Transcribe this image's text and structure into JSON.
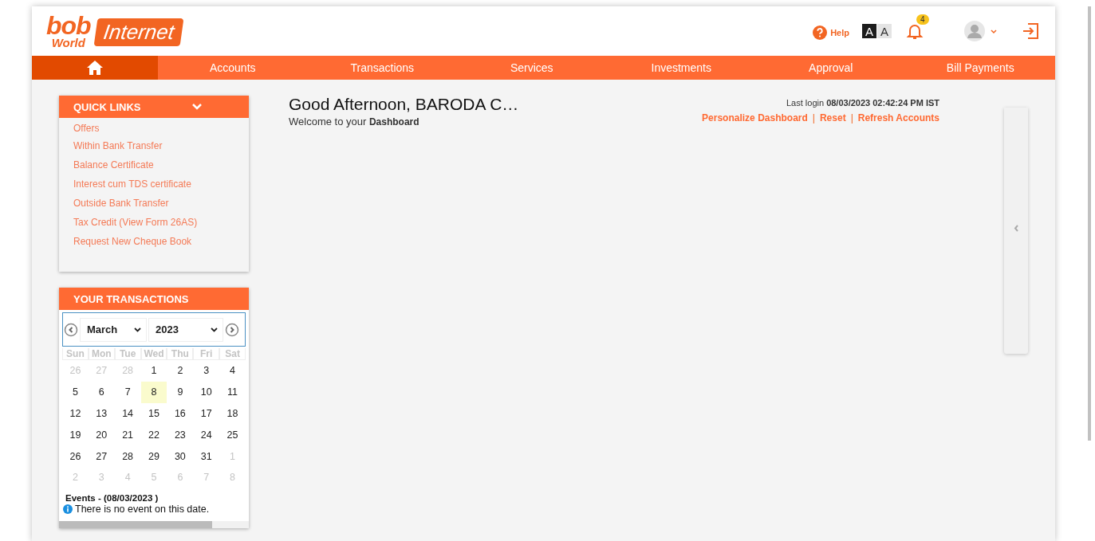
{
  "logo": {
    "brand": "bob",
    "sub": "World",
    "product": "Internet"
  },
  "header": {
    "help": "Help",
    "font_sizes": [
      {
        "label": "A",
        "selected": true
      },
      {
        "label": "A",
        "selected": false
      }
    ],
    "notifications": "4"
  },
  "nav": {
    "home_selected": true,
    "items": [
      {
        "label": "Accounts",
        "selected": false
      },
      {
        "label": "Transactions",
        "selected": false
      },
      {
        "label": "Services",
        "selected": false
      },
      {
        "label": "Investments",
        "selected": false
      },
      {
        "label": "Approval",
        "selected": false
      },
      {
        "label": "Bill Payments",
        "selected": false
      }
    ]
  },
  "quick_links": {
    "title": "QUICK LINKS",
    "expanded": true,
    "items": [
      "Offers",
      "Within Bank Transfer",
      "Balance Certificate",
      "Interest cum TDS certificate",
      "Outside Bank Transfer",
      "Tax Credit (View Form 26AS)",
      "Request New Cheque Book"
    ]
  },
  "transactions": {
    "title": "YOUR TRANSACTIONS",
    "month": "March",
    "year": "2023",
    "weekdays": [
      "Sun",
      "Mon",
      "Tue",
      "Wed",
      "Thu",
      "Fri",
      "Sat"
    ],
    "weeks": [
      [
        {
          "text": "26",
          "muted": true,
          "selected": false
        },
        {
          "text": "27",
          "muted": true,
          "selected": false
        },
        {
          "text": "28",
          "muted": true,
          "selected": false
        },
        {
          "text": "1",
          "muted": false,
          "selected": false
        },
        {
          "text": "2",
          "muted": false,
          "selected": false
        },
        {
          "text": "3",
          "muted": false,
          "selected": false
        },
        {
          "text": "4",
          "muted": false,
          "selected": false
        }
      ],
      [
        {
          "text": "5",
          "muted": false,
          "selected": false
        },
        {
          "text": "6",
          "muted": false,
          "selected": false
        },
        {
          "text": "7",
          "muted": false,
          "selected": false
        },
        {
          "text": "8",
          "muted": false,
          "selected": true
        },
        {
          "text": "9",
          "muted": false,
          "selected": false
        },
        {
          "text": "10",
          "muted": false,
          "selected": false
        },
        {
          "text": "11",
          "muted": false,
          "selected": false
        }
      ],
      [
        {
          "text": "12",
          "muted": false,
          "selected": false
        },
        {
          "text": "13",
          "muted": false,
          "selected": false
        },
        {
          "text": "14",
          "muted": false,
          "selected": false
        },
        {
          "text": "15",
          "muted": false,
          "selected": false
        },
        {
          "text": "16",
          "muted": false,
          "selected": false
        },
        {
          "text": "17",
          "muted": false,
          "selected": false
        },
        {
          "text": "18",
          "muted": false,
          "selected": false
        }
      ],
      [
        {
          "text": "19",
          "muted": false,
          "selected": false
        },
        {
          "text": "20",
          "muted": false,
          "selected": false
        },
        {
          "text": "21",
          "muted": false,
          "selected": false
        },
        {
          "text": "22",
          "muted": false,
          "selected": false
        },
        {
          "text": "23",
          "muted": false,
          "selected": false
        },
        {
          "text": "24",
          "muted": false,
          "selected": false
        },
        {
          "text": "25",
          "muted": false,
          "selected": false
        }
      ],
      [
        {
          "text": "26",
          "muted": false,
          "selected": false
        },
        {
          "text": "27",
          "muted": false,
          "selected": false
        },
        {
          "text": "28",
          "muted": false,
          "selected": false
        },
        {
          "text": "29",
          "muted": false,
          "selected": false
        },
        {
          "text": "30",
          "muted": false,
          "selected": false
        },
        {
          "text": "31",
          "muted": false,
          "selected": false
        },
        {
          "text": "1",
          "muted": true,
          "selected": false
        }
      ],
      [
        {
          "text": "2",
          "muted": true,
          "selected": false
        },
        {
          "text": "3",
          "muted": true,
          "selected": false
        },
        {
          "text": "4",
          "muted": true,
          "selected": false
        },
        {
          "text": "5",
          "muted": true,
          "selected": false
        },
        {
          "text": "6",
          "muted": true,
          "selected": false
        },
        {
          "text": "7",
          "muted": true,
          "selected": false
        },
        {
          "text": "8",
          "muted": true,
          "selected": false
        }
      ]
    ],
    "events_title": "Events - (08/03/2023 )",
    "events_message": "There is no event on this date."
  },
  "dashboard": {
    "greeting": "Good Afternoon, BARODA C…",
    "welcome": "Welcome to your **Dashboard**",
    "last_login": "Last login **08/03/2023 02:42:24 PM IST**",
    "links": [
      "Personalize Dashboard",
      "Reset",
      "Refresh Accounts"
    ],
    "separator": "|"
  }
}
